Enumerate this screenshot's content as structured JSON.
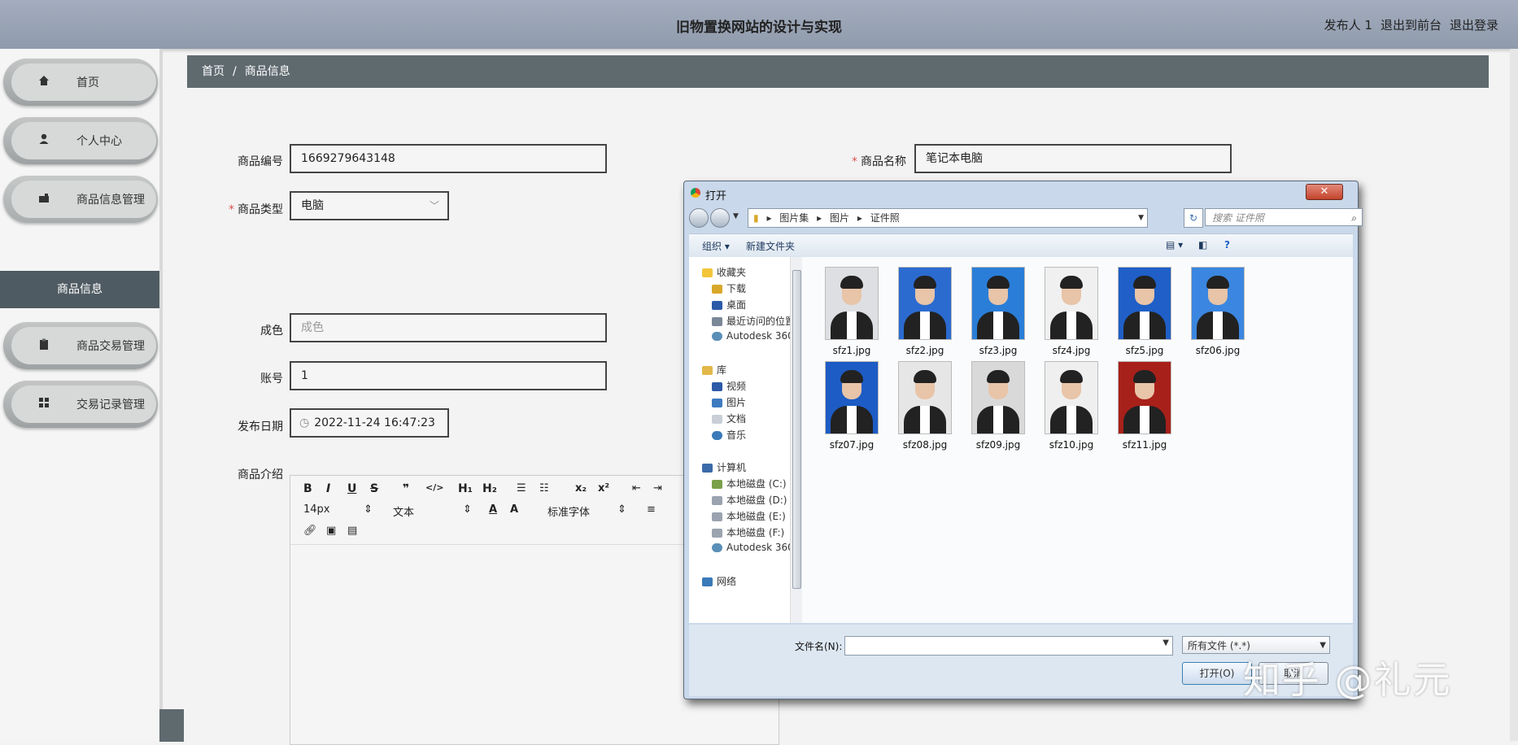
{
  "header": {
    "title": "旧物置换网站的设计与实现",
    "user": "发布人 1",
    "front_link": "退出到前台",
    "logout": "退出登录"
  },
  "sidebar": {
    "items": [
      {
        "label": "首页",
        "icon": "home-icon"
      },
      {
        "label": "个人中心",
        "icon": "user-icon"
      },
      {
        "label": "商品信息管理",
        "icon": "briefcase-icon"
      },
      {
        "label": "商品交易管理",
        "icon": "clipboard-icon"
      },
      {
        "label": "交易记录管理",
        "icon": "grid-icon"
      }
    ],
    "sub_active": "商品信息"
  },
  "breadcrumb": {
    "home": "首页",
    "sep": "/",
    "current": "商品信息"
  },
  "form": {
    "code_label": "商品编号",
    "code_value": "1669279643148",
    "name_label": "商品名称",
    "name_value": "笔记本电脑",
    "type_label": "商品类型",
    "type_value": "电脑",
    "condition_label": "成色",
    "condition_placeholder": "成色",
    "account_label": "账号",
    "account_value": "1",
    "date_label": "发布日期",
    "date_value": "2022-11-24 16:47:23",
    "intro_label": "商品介绍"
  },
  "editor": {
    "buttons": [
      "B",
      "I",
      "U",
      "S",
      "❞",
      "</>",
      "H₁",
      "H₂"
    ],
    "font_size": "14px",
    "text_type": "文本",
    "font_family": "标准字体"
  },
  "dialog": {
    "title": "打开",
    "close": "✕",
    "path": [
      "图片集",
      "图片",
      "证件照"
    ],
    "search_placeholder": "搜索 证件照",
    "organize": "组织 ▾",
    "new_folder": "新建文件夹",
    "tree": {
      "favorites": "收藏夹",
      "downloads": "下载",
      "desktop": "桌面",
      "recent": "最近访问的位置",
      "autodesk1": "Autodesk 360",
      "library": "库",
      "video": "视频",
      "pictures": "图片",
      "docs": "文档",
      "music": "音乐",
      "computer": "计算机",
      "c": "本地磁盘 (C:)",
      "d": "本地磁盘 (D:)",
      "e": "本地磁盘 (E:)",
      "f": "本地磁盘 (F:)",
      "autodesk2": "Autodesk 360",
      "network": "网络"
    },
    "files": [
      "sfz1.jpg",
      "sfz2.jpg",
      "sfz3.jpg",
      "sfz4.jpg",
      "sfz5.jpg",
      "sfz06.jpg",
      "sfz07.jpg",
      "sfz08.jpg",
      "sfz09.jpg",
      "sfz10.jpg",
      "sfz11.jpg"
    ],
    "file_bg": [
      "#dedfe3",
      "#2b6bd0",
      "#2a7ed8",
      "#f0f0f0",
      "#1f5fc7",
      "#3b86e0",
      "#1d5cc4",
      "#e6e6e6",
      "#d9d9d9",
      "#efefef",
      "#a8201a"
    ],
    "filename_label": "文件名(N):",
    "filetype": "所有文件 (*.*)",
    "open": "打开(O)",
    "cancel": "取消"
  },
  "watermark": "知乎 @礼元"
}
